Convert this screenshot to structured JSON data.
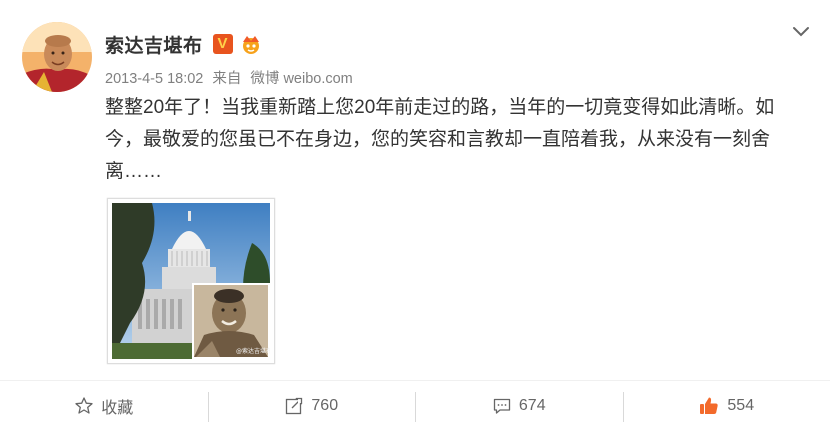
{
  "post": {
    "author": "索达吉堪布",
    "verified_badge": "V",
    "timestamp": "2013-4-5 18:02",
    "source_prefix": "来自",
    "source_app": "微博 weibo.com",
    "text": "整整20年了！当我重新踏上您20年前走过的路，当年的一切竟变得如此清晰。如今，最敬爱的您虽已不在身边，您的笑容和言教却一直陪着我，从来没有一刻舍离……",
    "image_watermark": "@索达吉堪布"
  },
  "actions": {
    "favorite_label": "收藏",
    "repost_count": "760",
    "comment_count": "674",
    "like_count": "554"
  },
  "colors": {
    "accent_orange": "#e8541e",
    "like_orange": "#f36a2b",
    "text_main": "#333333",
    "text_meta": "#808080"
  },
  "icons": [
    "chevron-down-icon",
    "crown-icon",
    "star-icon",
    "repost-icon",
    "comment-icon",
    "thumbs-up-icon"
  ]
}
